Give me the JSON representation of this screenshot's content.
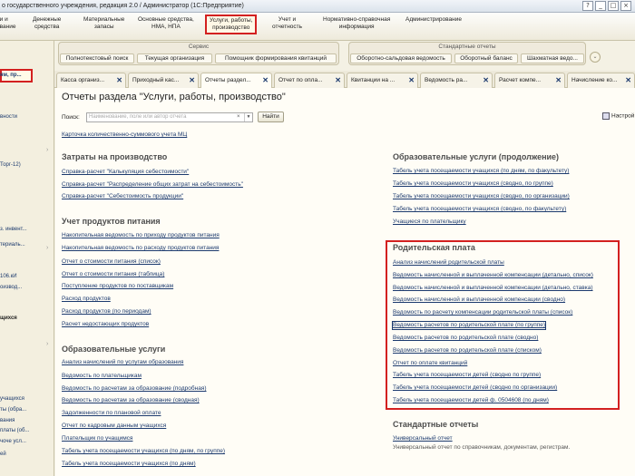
{
  "window": {
    "title": "о государственного учреждения, редакция 2.0 / Администратор  (1С:Предприятие)",
    "buttons": [
      "?",
      "_",
      "□",
      "×"
    ]
  },
  "menu": {
    "items": [
      {
        "label": "ии и\nование"
      },
      {
        "label": "Денежные\nсредства"
      },
      {
        "label": "Материальные\nзапасы"
      },
      {
        "label": "Основные средства,\nНМА, НПА"
      },
      {
        "label": "Услуги, работы,\nпроизводство"
      },
      {
        "label": "Учет и\nотчетность"
      },
      {
        "label": "Нормативно-справочная\nинформация"
      },
      {
        "label": "Администрирование"
      }
    ]
  },
  "groups": {
    "service": {
      "header": "Сервис",
      "items": [
        "Полнотекстовый поиск",
        "Текущая организация",
        "Помощник формирования квитанций"
      ]
    },
    "std_reports": {
      "header": "Стандартные отчеты",
      "items": [
        "Оборотно-сальдовая ведомость",
        "Оборотный баланс",
        "Шахматная ведо..."
      ]
    }
  },
  "sidebar": {
    "items": [
      "ям, пр...",
      "вности",
      "Торг-12)",
      "з. инвент...",
      "териаль...",
      "106.кИ",
      "оизвод...",
      "щихся",
      "учащихся",
      "ты (обра...",
      "вания",
      "платы (об...",
      "чоче усл...",
      "ей"
    ]
  },
  "open_tabs": [
    {
      "label": "Касса организ..."
    },
    {
      "label": "Приходный кас..."
    },
    {
      "label": "Отчеты раздел..."
    },
    {
      "label": "Отчет по опла..."
    },
    {
      "label": "Квитанции на ..."
    },
    {
      "label": "Ведомость ра..."
    },
    {
      "label": "Расчет компе..."
    },
    {
      "label": "Начисление ко..."
    }
  ],
  "page": {
    "title": "Отчеты раздела \"Услуги, работы, производство\"",
    "search_label": "Поиск:",
    "search_placeholder": "Наименование, поле или автор отчета",
    "find_button": "Найти",
    "settings_label": "Настрой",
    "top_link": "Карточка количественно-суммового учета МЦ"
  },
  "sections": {
    "costs": {
      "title": "Затраты на производство",
      "links": [
        "Справка-расчет \"Калькуляция себестоимости\"",
        "Справка-расчет \"Распределение общих затрат на себестоимость\"",
        "Справка-расчет \"Себестоимость продукции\""
      ]
    },
    "food": {
      "title": "Учет продуктов питания",
      "links": [
        "Накопительная ведомость по приходу продуктов питания",
        "Накопительная ведомость по расходу продуктов питания",
        "Отчет о стоимости питания (список)",
        "Отчет о стоимости питания (таблица)",
        "Поступление продуктов по поставщикам",
        "Расход продуктов",
        "Расход продуктов (по периодам)",
        "Расчет недостающих продуктов"
      ]
    },
    "edu": {
      "title": "Образовательные услуги",
      "links": [
        "Анализ начислений по услугам образования",
        "Ведомость по плательщикам",
        "Ведомость по расчетам за образование (подробная)",
        "Ведомость по расчетам за образование (сводная)",
        "Задолженности по плановой оплате",
        "Отчет по кадровым данным учащихся",
        "Плательщик по учащимся",
        "Табель учета посещаемости учащихся (по дням, по группе)",
        "Табель учета посещаемости учащихся (по дням)"
      ]
    },
    "edu_cont": {
      "title": "Образовательные услуги (продолжение)",
      "links": [
        "Табель учета посещаемости учащихся (по дням, по факультету)",
        "Табель учета посещаемости учащихся (сводно, по группе)",
        "Табель учета посещаемости учащихся (сводно, по организации)",
        "Табель учета посещаемости учащихся (сводно, по факультету)",
        "Учащиеся по плательщику"
      ]
    },
    "parent": {
      "title": "Родительская плата",
      "links": [
        "Анализ начислений родительской платы",
        "Ведомость начисленной и выплаченной компенсации (детально, список)",
        "Ведомость начисленной и выплаченной компенсации (детально, ставка)",
        "Ведомость начисленной и выплаченной компенсации (сводно)",
        "Ведомость по расчету компенсации родительской платы (список)",
        "Ведомость расчетов по родительской плате (по группе)",
        "Ведомость расчетов по родительской плате (сводно)",
        "Ведомость расчетов по родительской плате (списком)",
        "Отчет по оплате квитанций",
        "Табель учета посещаемости детей (сводно по группе)",
        "Табель учета посещаемости детей (сводно по организации)",
        "Табель учета посещаемости детей ф. 0504608 (по дням)"
      ]
    },
    "std": {
      "title": "Стандартные отчеты",
      "link": "Универсальный отчет",
      "desc": "Универсальный отчет по справочникам, документам, регистрам."
    }
  },
  "colors": {
    "accent_red": "#d32020",
    "link": "#1c3a6e",
    "background": "#fffdf6"
  }
}
